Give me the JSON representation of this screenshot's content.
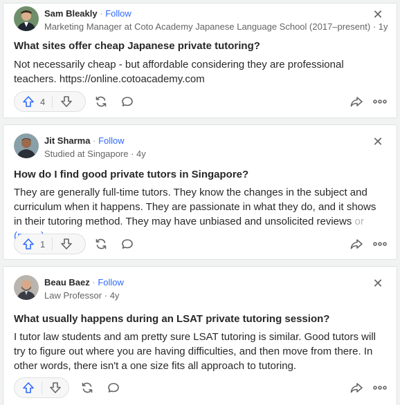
{
  "feed": [
    {
      "author": "Sam Bleakly",
      "separator": "·",
      "follow_label": "Follow",
      "credential": "Marketing Manager at Coto Academy Japanese Language School (2017–present)",
      "time": "1y",
      "question": "What sites offer cheap Japanese private tutoring?",
      "answer": "Not necessarily cheap - but affordable considering they are professional teachers. https://online.cotoacademy.com",
      "upvotes": "4",
      "accent": "#2e69ff"
    },
    {
      "author": "Jit Sharma",
      "separator": "·",
      "follow_label": "Follow",
      "credential": "Studied at Singapore",
      "time": "4y",
      "question": "How do I find good private tutors in Singapore?",
      "answer": "They are generally full-time tutors. They know the changes in the subject and curriculum when it happens. They are passionate in what they do, and it shows in their tutoring method. They may have unbiased and unsolicited reviews",
      "answer_fade": "or",
      "more_label": "(more)",
      "upvotes": "1"
    },
    {
      "author": "Beau Baez",
      "separator": "·",
      "follow_label": "Follow",
      "credential": "Law Professor",
      "time": "4y",
      "question": "What usually happens during an LSAT private tutoring session?",
      "answer": "I tutor law students and am pretty sure LSAT tutoring is similar. Good tutors will try to figure out where you are having difficulties, and then move from there. In other words, there isn't a one size fits all approach to tutoring.",
      "upvotes": ""
    }
  ],
  "icons": {
    "upvote": "upvote-arrow-icon",
    "downvote": "downvote-arrow-icon",
    "share_loop": "reshare-icon",
    "comment": "comment-bubble-icon",
    "share": "share-arrow-icon",
    "more": "more-dots-icon",
    "close": "close-icon"
  },
  "colors": {
    "accent": "#2e69ff",
    "text": "#282829",
    "muted": "#636466",
    "background": "#f1f2f2"
  },
  "close_glyph": "✕",
  "more_glyph": "•••"
}
